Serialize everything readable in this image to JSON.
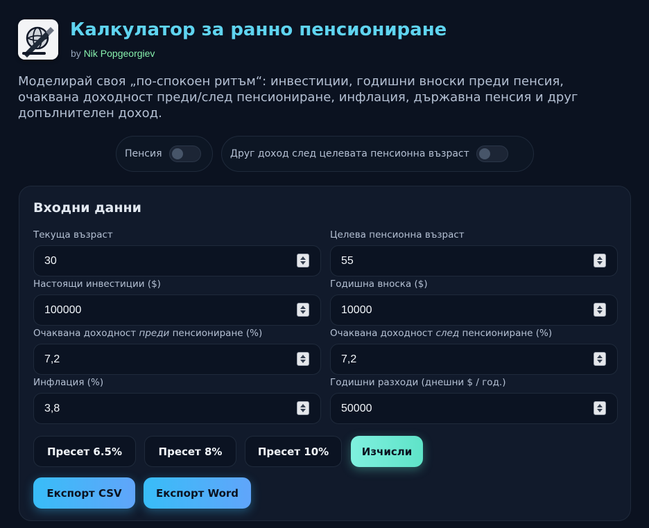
{
  "header": {
    "title": "Калкулатор за ранно пенсиониране",
    "by_prefix": "by",
    "author": "Nik Popgeorgiev",
    "logo_icon": "globe-pen-icon"
  },
  "description": "Моделирай своя „по-спокоен ритъм“: инвестиции, годишни вноски преди пенсия, очаквана доходност преди/след пенсиониране, инфлация, държавна пенсия и друг допълнителен доход.",
  "toggles": [
    {
      "label": "Пенсия",
      "on": false
    },
    {
      "label": "Друг доход след целевата пенсионна възраст",
      "on": false
    }
  ],
  "inputs_card": {
    "title": "Входни данни",
    "fields": {
      "current_age": {
        "label": "Текуща възраст",
        "value": "30"
      },
      "target_age": {
        "label": "Целева пенсионна възраст",
        "value": "55"
      },
      "investments": {
        "label": "Настоящи инвестиции ($)",
        "value": "100000"
      },
      "annual_contribution": {
        "label": "Годишна вноска ($)",
        "value": "10000"
      },
      "return_before": {
        "label_pre": "Очаквана доходност ",
        "label_em": "преди",
        "label_post": " пенсиониране (%)",
        "value": "7,2"
      },
      "return_after": {
        "label_pre": "Очаквана доходност ",
        "label_em": "след",
        "label_post": " пенсиониране (%)",
        "value": "7,2"
      },
      "inflation": {
        "label": "Инфлация (%)",
        "value": "3,8"
      },
      "annual_expenses": {
        "label": "Годишни разходи (днешни $ / год.)",
        "value": "50000"
      }
    },
    "buttons": {
      "preset_1": "Пресет 6.5%",
      "preset_2": "Пресет 8%",
      "preset_3": "Пресет 10%",
      "calculate": "Изчисли",
      "export_csv": "Експорт CSV",
      "export_word": "Експорт Word"
    }
  },
  "colors": {
    "background": "#0b1220",
    "title": "#5fd4f0",
    "author": "#86efac",
    "calc_button": "#7ff0df",
    "export_button": "#38bdf8"
  }
}
